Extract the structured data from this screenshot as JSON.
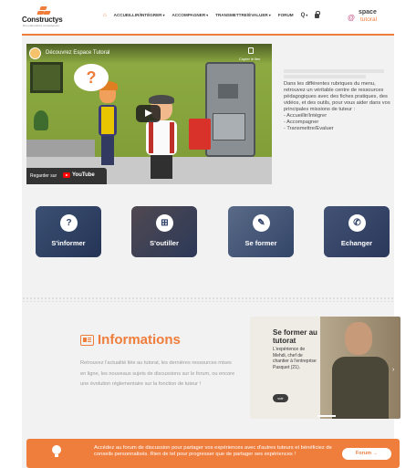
{
  "header": {
    "logo_text": "Constructys",
    "logo_tagline": "Des partenaires compétences",
    "nav": [
      {
        "label": "ACCUEILLIR/INTÉGRER"
      },
      {
        "label": "ACCOMPAGNER"
      },
      {
        "label": "TRANSMETTRE/ÉVALUER"
      },
      {
        "label": "FORUM"
      }
    ],
    "search_icon": "Q",
    "espace_logo": "@",
    "espace_word": "space",
    "espace_sub": "tutoral"
  },
  "video": {
    "title": "Découvrez Espace Tutoral",
    "copy_label": "Copier le lien",
    "watch_on": "Regarder sur",
    "platform": "YouTube",
    "bubble": "?"
  },
  "intro": {
    "paragraph": "Dans les différentes rubriques du menu, retrouvez un véritable centre de ressources pédagogiques avec des fiches pratiques, des vidéos, et des outils, pour vous aider dans vos principales missions de tuteur :",
    "missions": [
      "- Accueillir/Intégrer",
      "- Accompagner",
      "- Transmettre/Evaluer"
    ]
  },
  "categories": [
    {
      "label": "S'informer",
      "icon": "question-icon",
      "glyph": "?"
    },
    {
      "label": "S'outiller",
      "icon": "toolbox-icon",
      "glyph": "⊞"
    },
    {
      "label": "Se former",
      "icon": "certificate-icon",
      "glyph": "✎"
    },
    {
      "label": "Echanger",
      "icon": "chat-icon",
      "glyph": "✆"
    }
  ],
  "informations": {
    "title": "Informations",
    "text": "Retrouvez l'actualité liée au tutorat, les dernières ressources mises en ligne, les nouveaux sujets de discussions sur le forum, ou encore une évolution réglementaire sur la fonction de tuteur !"
  },
  "carousel": {
    "title": "Se former au tutorat",
    "description": "L'expérience de Mehdi, chef de chantier à l'entreprise Pasquet (21).",
    "button": "voir",
    "arrow": "›"
  },
  "banner": {
    "text": "Accédez au forum de discussion pour partager vos expériences avec d'autres tuteurs et bénéficiez de conseils personnalisés. Rien de tel pour progresser que de partager ses expériences !",
    "button": "Forum →"
  },
  "colors": {
    "accent": "#ef7d3c",
    "card_blue": "#2d3e66"
  }
}
